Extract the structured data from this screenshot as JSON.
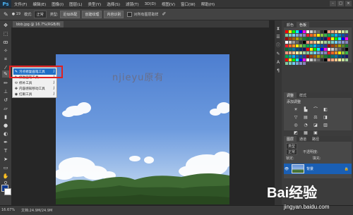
{
  "app": {
    "logo": "Ps"
  },
  "menu": [
    "文件(F)",
    "编辑(E)",
    "图像(I)",
    "图层(L)",
    "类型(Y)",
    "选择(S)",
    "滤镜(T)",
    "3D(D)",
    "视图(V)",
    "窗口(W)",
    "帮助(H)"
  ],
  "window_controls": [
    "–",
    "□",
    "×"
  ],
  "options": {
    "brush_size": "19",
    "mode_label": "模式:",
    "mode_value": "正常",
    "type_label": "类型:",
    "type_btn1": "近似匹配",
    "type_btn2": "创建纹理",
    "type_btn3": "内容识别",
    "sample_all": "对所有图层取样"
  },
  "document_tab": "bbb.jpg @ 16.7%(RGB/8)",
  "flyout": {
    "items": [
      {
        "label": "污点修复画笔工具",
        "key": "J"
      },
      {
        "label": "修复画笔工具",
        "key": "J"
      },
      {
        "label": "修补工具",
        "key": "J"
      },
      {
        "label": "内容感知移动工具",
        "key": "J"
      },
      {
        "label": "红眼工具",
        "key": "J"
      }
    ]
  },
  "canvas": {
    "watermark": "njieyu原有"
  },
  "right_panels": {
    "color_tabs": [
      "颜色",
      "色板"
    ],
    "adjust_tabs": [
      "调整",
      "样式"
    ],
    "adjust_title": "添加调整",
    "layer_tabs": [
      "图层",
      "通道",
      "路径"
    ],
    "kind_label": "类型",
    "blend_mode": "正常",
    "opacity_label": "不透明度:",
    "lock_label": "锁定:",
    "fill_label": "填充:",
    "layer_name": "背景"
  },
  "status": {
    "zoom": "16.67%",
    "doc": "文档:24.9M/24.9M"
  },
  "baidu": {
    "logo_text": "Bai经验",
    "url": "jingyan.baidu.com"
  },
  "colors": {
    "highlight": "#e02020",
    "active": "#1f6fc7"
  },
  "icons": [
    "move-icon",
    "marquee-icon",
    "lasso-icon",
    "quick-select-icon",
    "crop-icon",
    "eyedropper-icon",
    "healing-brush-icon",
    "brush-icon",
    "stamp-icon",
    "history-brush-icon",
    "eraser-icon",
    "gradient-icon",
    "blur-icon",
    "dodge-icon",
    "pen-icon",
    "type-icon",
    "path-select-icon",
    "shape-icon",
    "hand-icon",
    "zoom-icon"
  ]
}
